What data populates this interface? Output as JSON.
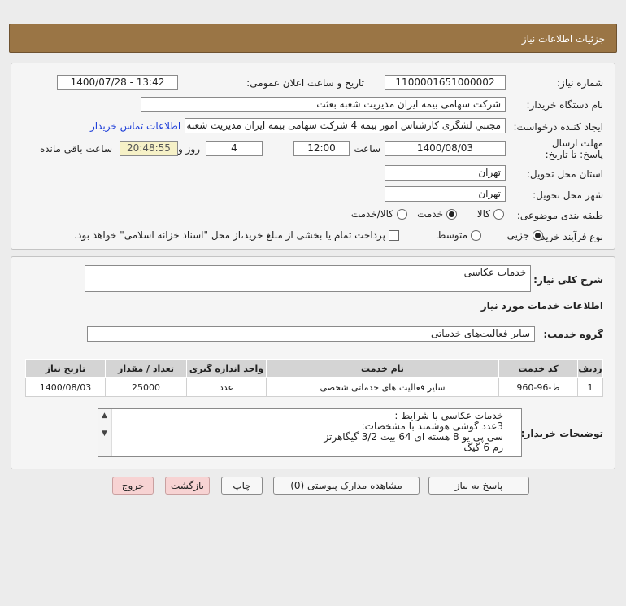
{
  "header": {
    "title": "جزئیات اطلاعات نیاز"
  },
  "info": {
    "need_number_label": "شماره نیاز:",
    "need_number": "1100001651000002",
    "announce_label": "تاریخ و ساعت اعلان عمومی:",
    "announce_value": "1400/07/28 - 13:42",
    "buyer_org_label": "نام دستگاه خریدار:",
    "buyer_org": "شرکت سهامی بیمه ایران مدیریت شعبه بعثت",
    "requester_label": "ایجاد کننده درخواست:",
    "requester": "مجتبي لشگری كارشناس امور بيمه 4 شرکت سهامی بیمه ایران مدیریت شعبه",
    "contact_link": "اطلاعات تماس خریدار",
    "deadline_label": "مهلت ارسال پاسخ: تا تاریخ:",
    "deadline_date": "1400/08/03",
    "time_label": "ساعت",
    "deadline_time": "12:00",
    "days_value": "4",
    "days_label": "روز و",
    "remaining_time": "20:48:55",
    "remaining_label": "ساعت باقی مانده",
    "province_label": "استان محل تحویل:",
    "province": "تهران",
    "city_label": "شهر محل تحویل:",
    "city": "تهران",
    "category_label": "طبقه بندی موضوعی:",
    "category_options": [
      "کالا",
      "خدمت",
      "کالا/خدمت"
    ],
    "category_selected": "خدمت",
    "process_label": "نوع فرآیند خرید :",
    "process_options": [
      "جزیی",
      "متوسط"
    ],
    "process_selected": "جزیی",
    "payment_note": "پرداخت تمام یا بخشی از مبلغ خرید،از محل \"اسناد خزانه اسلامی\" خواهد بود."
  },
  "details": {
    "summary_label": "شرح کلی نیاز:",
    "summary": "خدمات عکاسی",
    "services_heading": "اطلاعات خدمات مورد نیاز",
    "group_label": "گروه خدمت:",
    "group": "سایر فعالیت‌های خدماتی",
    "table": {
      "headers": [
        "ردیف",
        "کد خدمت",
        "نام خدمت",
        "واحد اندازه گیری",
        "تعداد / مقدار",
        "تاریخ نیاز"
      ],
      "rows": [
        {
          "row": "1",
          "code": "ط-96-960",
          "name": "سایر فعالیت های خدماتی شخصی",
          "unit": "عدد",
          "qty": "25000",
          "date": "1400/08/03"
        }
      ]
    },
    "buyer_desc_label": "توضیحات خریدار:",
    "buyer_desc_lines": [
      "خدمات عکاسی با شرایط :",
      "3عدد گوشی هوشمند با مشخصات:",
      "سی پی یو 8 هسته ای 64 بیت 3/2 گیگاهرتز",
      "رم 6 گیگ"
    ]
  },
  "buttons": {
    "reply": "پاسخ به نیاز",
    "attachments": "مشاهده مدارک پیوستی (0)",
    "print": "چاپ",
    "back": "بازگشت",
    "exit": "خروج"
  }
}
